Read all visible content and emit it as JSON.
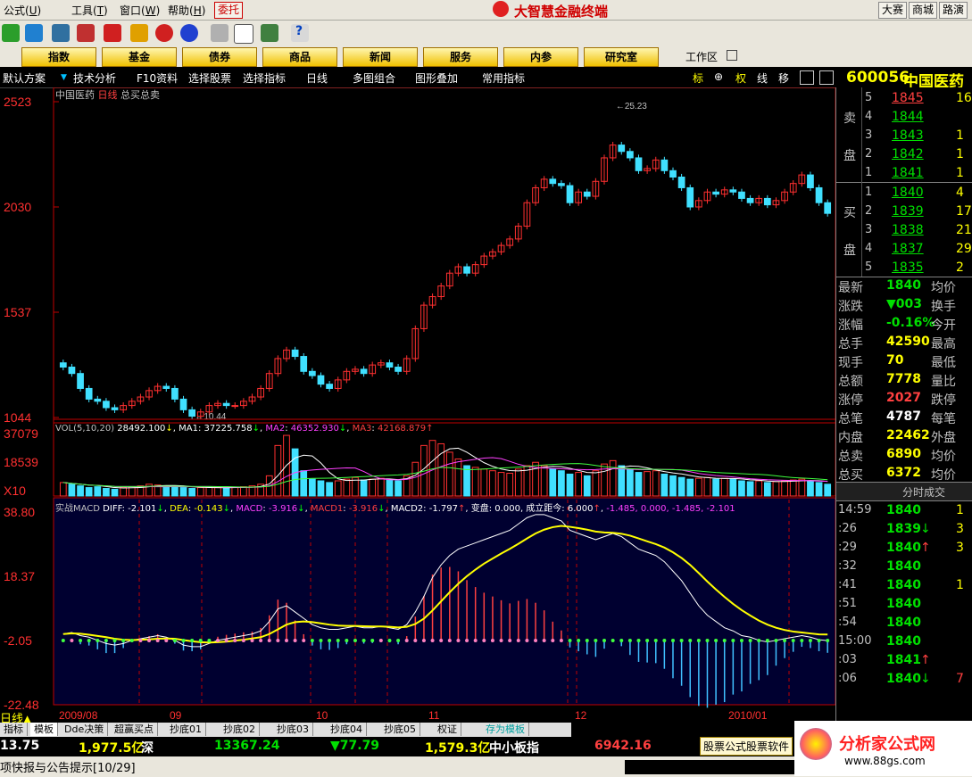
{
  "menu": {
    "items": [
      "公式",
      "工具",
      "窗口",
      "帮助"
    ],
    "mnemonics": [
      "U",
      "T",
      "W",
      "H"
    ],
    "delegate": "委托",
    "app_title": "大智慧金融终端",
    "right_buttons": [
      "大赛",
      "商城",
      "路演"
    ]
  },
  "nav": {
    "buttons": [
      "指数",
      "基金",
      "债券",
      "商品",
      "新闻",
      "服务",
      "内参",
      "研究室"
    ],
    "workspace": "工作区"
  },
  "subtool": {
    "items": [
      "默认方案",
      "技术分析",
      "F10资料",
      "选择股票",
      "选择指标",
      "日线",
      "多图组合",
      "图形叠加",
      "常用指标"
    ],
    "right_icons": [
      "标",
      "⊕",
      "权",
      "线",
      "移"
    ]
  },
  "chart_header": {
    "stock": "中国医药",
    "period": "日线",
    "indicator": "总买总卖"
  },
  "chart_data": [
    {
      "type": "candlestick",
      "title": "中国医药 日线",
      "y_ticks": [
        "2523",
        "2030",
        "1537",
        "1044"
      ],
      "ylim": [
        1044,
        2523
      ],
      "annotations": [
        {
          "label": "25.23",
          "value": 2523
        },
        {
          "label": "10.44",
          "value": 1044
        }
      ],
      "close": [
        1280,
        1250,
        1180,
        1130,
        1120,
        1090,
        1080,
        1100,
        1120,
        1140,
        1170,
        1190,
        1180,
        1130,
        1080,
        1050,
        1070,
        1100,
        1110,
        1100,
        1100,
        1120,
        1140,
        1180,
        1250,
        1320,
        1360,
        1330,
        1260,
        1240,
        1200,
        1180,
        1220,
        1260,
        1270,
        1250,
        1290,
        1300,
        1280,
        1260,
        1320,
        1460,
        1570,
        1610,
        1660,
        1720,
        1750,
        1720,
        1760,
        1800,
        1820,
        1850,
        1880,
        1940,
        2050,
        2120,
        2160,
        2140,
        2130,
        2050,
        2100,
        2080,
        2150,
        2260,
        2320,
        2290,
        2260,
        2200,
        2210,
        2250,
        2200,
        2170,
        2120,
        2030,
        2060,
        2100,
        2090,
        2110,
        2100,
        2070,
        2050,
        2070,
        2040,
        2060,
        2100,
        2140,
        2180,
        2120,
        2050,
        2000
      ]
    },
    {
      "type": "bar",
      "title": "VOL(5,10,20)",
      "y_ticks": [
        "37079",
        "18539",
        "X10"
      ],
      "ylim": [
        0,
        37079
      ],
      "legend": [
        {
          "name": "VOL",
          "value": "28492.100"
        },
        {
          "name": "MA1",
          "value": "37225.758"
        },
        {
          "name": "MA2",
          "value": "46352.930"
        },
        {
          "name": "MA3",
          "value": "42168.879"
        }
      ],
      "values": [
        8000,
        7000,
        6000,
        5000,
        5500,
        4500,
        4000,
        5000,
        5500,
        6000,
        7000,
        6500,
        6000,
        5500,
        5000,
        4500,
        5000,
        5200,
        5000,
        4800,
        5000,
        5500,
        6000,
        7000,
        12000,
        30000,
        36000,
        28000,
        15000,
        10000,
        9000,
        8000,
        9000,
        10000,
        11000,
        9500,
        10000,
        10500,
        9800,
        9000,
        12000,
        20000,
        30000,
        33000,
        31000,
        26000,
        22000,
        18000,
        17000,
        16000,
        15000,
        14000,
        13500,
        16000,
        18000,
        20000,
        18000,
        16000,
        15000,
        13000,
        14000,
        12000,
        15000,
        19000,
        21000,
        18000,
        16000,
        14000,
        14500,
        15000,
        13000,
        12000,
        11000,
        10000,
        10500,
        11000,
        10000,
        10500,
        10000,
        9000,
        8500,
        9000,
        8000,
        8500,
        9000,
        9500,
        10000,
        9000,
        8000,
        7000
      ]
    },
    {
      "type": "line",
      "title": "实战MACD",
      "y_ticks": [
        "38.80",
        "18.37",
        "-2.05",
        "-22.48"
      ],
      "ylim": [
        -22.48,
        38.8
      ],
      "legend": [
        {
          "name": "DIFF",
          "value": "-2.101"
        },
        {
          "name": "DEA",
          "value": "-0.143"
        },
        {
          "name": "MACD",
          "value": "-3.916"
        },
        {
          "name": "MACD1",
          "value": "-3.916"
        },
        {
          "name": "MACD2",
          "value": "-1.797"
        },
        {
          "name": "变盘",
          "value": "0.000"
        },
        {
          "name": "成立距今",
          "value": "6.000"
        }
      ],
      "extra_values": "-1.485, 0.000, -1.485, -2.101",
      "series": [
        {
          "name": "DIFF",
          "values": [
            0,
            0.5,
            -0.5,
            -1,
            -2,
            -3,
            -3.5,
            -3,
            -2,
            -1.5,
            -1,
            -0.5,
            -1,
            -2,
            -3.5,
            -4,
            -4,
            -3,
            -2,
            -1.5,
            -1,
            -0.5,
            0,
            1,
            4,
            8,
            9,
            7,
            5,
            3,
            2,
            1.5,
            1.5,
            2,
            2.5,
            2,
            2,
            2.5,
            2,
            1.5,
            3,
            7,
            12,
            18,
            22,
            25,
            27,
            28,
            29,
            30,
            31,
            32,
            33,
            35,
            37,
            38,
            38,
            37,
            36,
            33,
            32,
            31,
            30,
            31,
            32,
            31,
            29,
            27,
            26,
            25,
            23,
            20,
            17,
            13,
            9,
            6,
            4,
            2,
            1,
            -0.5,
            -1,
            -2,
            -2.5,
            -2,
            -1.5,
            -1,
            -0.5,
            -1,
            -1.8,
            -2.1
          ]
        },
        {
          "name": "DEA",
          "values": [
            0,
            0.2,
            0.1,
            -0.2,
            -0.6,
            -1,
            -1.5,
            -1.8,
            -1.9,
            -1.8,
            -1.7,
            -1.5,
            -1.4,
            -1.5,
            -1.9,
            -2.3,
            -2.6,
            -2.7,
            -2.6,
            -2.4,
            -2.1,
            -1.8,
            -1.4,
            -1,
            0,
            1.5,
            3,
            3.8,
            4,
            3.8,
            3.4,
            3,
            2.7,
            2.6,
            2.6,
            2.5,
            2.4,
            2.4,
            2.3,
            2.1,
            2.3,
            3.2,
            4.9,
            7.5,
            10.4,
            13.3,
            16,
            18.4,
            20.5,
            22.4,
            24,
            25.6,
            27.1,
            28.7,
            30.4,
            32,
            33.2,
            34,
            34.4,
            34.1,
            33.7,
            33.2,
            32.6,
            32.3,
            32.2,
            31.9,
            31.3,
            30.4,
            29.5,
            28.6,
            27.5,
            26,
            24.2,
            22,
            19.4,
            16.7,
            14.2,
            11.8,
            9.6,
            7.6,
            5.9,
            4.3,
            3,
            2,
            1.3,
            0.8,
            0.5,
            0.2,
            -0.1,
            -0.14
          ]
        }
      ],
      "x_ticks": [
        "2009/08",
        "09",
        "10",
        "11",
        "12",
        "2010/01"
      ]
    }
  ],
  "quote": {
    "code": "600056",
    "name": "中国医药",
    "sell_label": [
      "卖",
      "盘"
    ],
    "buy_label": [
      "买",
      "盘"
    ],
    "sell": [
      {
        "level": "5",
        "price": "1845",
        "vol": "16"
      },
      {
        "level": "4",
        "price": "1844",
        "vol": ""
      },
      {
        "level": "3",
        "price": "1843",
        "vol": "1"
      },
      {
        "level": "2",
        "price": "1842",
        "vol": "1"
      },
      {
        "level": "1",
        "price": "1841",
        "vol": "1"
      }
    ],
    "buy": [
      {
        "level": "1",
        "price": "1840",
        "vol": "4"
      },
      {
        "level": "2",
        "price": "1839",
        "vol": "17"
      },
      {
        "level": "3",
        "price": "1838",
        "vol": "21"
      },
      {
        "level": "4",
        "price": "1837",
        "vol": "29"
      },
      {
        "level": "5",
        "price": "1835",
        "vol": "2"
      }
    ],
    "stats": [
      {
        "label": "最新",
        "value": "1840",
        "label2": "均价"
      },
      {
        "label": "涨跌",
        "value": "▼003",
        "label2": "换手"
      },
      {
        "label": "涨幅",
        "value": "-0.16%",
        "label2": "今开"
      },
      {
        "label": "总手",
        "value": "42590",
        "label2": "最高"
      },
      {
        "label": "现手",
        "value": "70",
        "label2": "最低"
      },
      {
        "label": "总额",
        "value": "7778",
        "label2": "量比"
      },
      {
        "label": "涨停",
        "value": "2027",
        "label2": "跌停"
      },
      {
        "label": "总笔",
        "value": "4787",
        "label2": "每笔"
      },
      {
        "label": "内盘",
        "value": "22462",
        "label2": "外盘"
      },
      {
        "label": "总卖",
        "value": "6890",
        "label2": "均价"
      },
      {
        "label": "总买",
        "value": "6372",
        "label2": "均价"
      }
    ],
    "ticks_title": "分时成交",
    "ticks": [
      {
        "time": "14:59",
        "price": "1840",
        "arrow": "",
        "vol": "1"
      },
      {
        "time": ":26",
        "price": "1839",
        "arrow": "↓",
        "vol": "3"
      },
      {
        "time": ":29",
        "price": "1840",
        "arrow": "↑",
        "vol": "3"
      },
      {
        "time": ":32",
        "price": "1840",
        "arrow": "",
        "vol": ""
      },
      {
        "time": ":41",
        "price": "1840",
        "arrow": "",
        "vol": "1"
      },
      {
        "time": ":51",
        "price": "1840",
        "arrow": "",
        "vol": ""
      },
      {
        "time": ":54",
        "price": "1840",
        "arrow": "",
        "vol": ""
      },
      {
        "time": "15:00",
        "price": "1840",
        "arrow": "",
        "vol": ""
      },
      {
        "time": ":03",
        "price": "1841",
        "arrow": "↑",
        "vol": ""
      },
      {
        "time": ":06",
        "price": "1840",
        "arrow": "↓",
        "vol": "7"
      }
    ]
  },
  "bottom": {
    "period_label": "日线",
    "tabs": [
      "指标",
      "模板",
      "Dde决策",
      "超赢买点",
      "抄底01",
      "抄底02",
      "抄底03",
      "抄底04",
      "抄底05",
      "权证",
      "存为模板"
    ],
    "status": [
      {
        "text": "13.75",
        "color": "#ffffff"
      },
      {
        "text": "1,977.5亿",
        "color": "#ffff00"
      },
      {
        "text": "深",
        "color": "#ffffff"
      },
      {
        "text": "13367.24",
        "color": "#00e000"
      },
      {
        "text": "▼77.79",
        "color": "#00e000"
      },
      {
        "text": "1,579.3亿",
        "color": "#ffff00"
      },
      {
        "text": "中小板指",
        "color": "#ffffff"
      },
      {
        "text": "6942.16",
        "color": "#ff4040"
      }
    ],
    "ticker": "项快报与公告提示[10/29]",
    "ad_text": "股票公式股票软件",
    "watermark": "分析家公式网",
    "watermark_url": "www.88gs.com"
  }
}
